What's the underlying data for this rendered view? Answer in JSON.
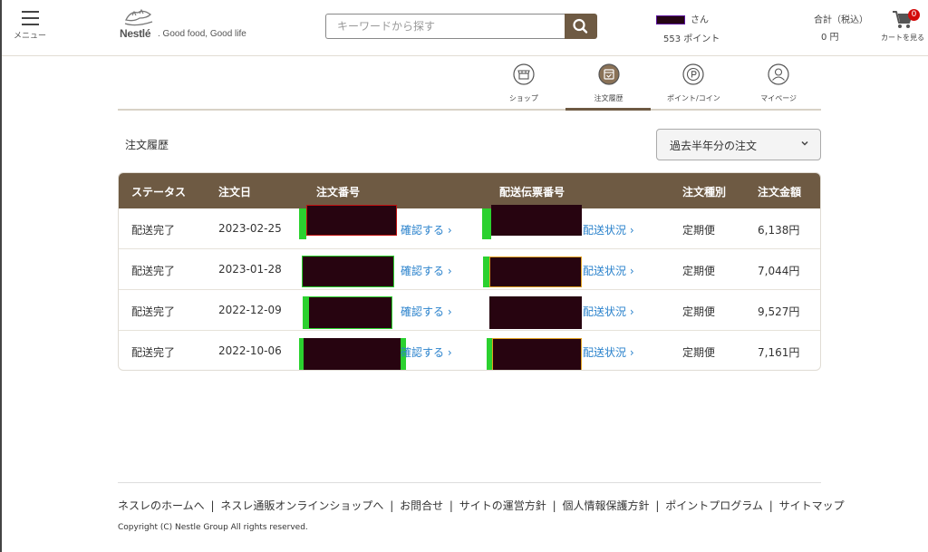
{
  "header": {
    "menu_label": "メニュー",
    "brand": "Nestlé",
    "tagline": ". Good food, Good life",
    "search_placeholder": "キーワードから探す",
    "user_suffix": "さん",
    "points": "553 ポイント",
    "total_label": "合計（税込）",
    "total_value": "0 円",
    "cart_count": "0",
    "cart_label": "カートを見る"
  },
  "tabs": [
    {
      "label": "ショップ",
      "icon": "shop-icon"
    },
    {
      "label": "注文履歴",
      "icon": "order-history-icon",
      "active": true
    },
    {
      "label": "ポイント/コイン",
      "icon": "points-coin-icon"
    },
    {
      "label": "マイページ",
      "icon": "mypage-icon"
    }
  ],
  "page": {
    "title": "注文履歴",
    "period_select": "過去半年分の注文"
  },
  "table": {
    "headers": [
      "ステータス",
      "注文日",
      "注文番号",
      "配送伝票番号",
      "注文種別",
      "注文金額"
    ],
    "confirm_label": "確認する",
    "tracking_label": "配送状況",
    "rows": [
      {
        "status": "配送完了",
        "date": "2023-02-25",
        "type": "定期便",
        "amount": "6,138円"
      },
      {
        "status": "配送完了",
        "date": "2023-01-28",
        "type": "定期便",
        "amount": "7,044円"
      },
      {
        "status": "配送完了",
        "date": "2022-12-09",
        "type": "定期便",
        "amount": "9,527円"
      },
      {
        "status": "配送完了",
        "date": "2022-10-06",
        "type": "定期便",
        "amount": "7,161円"
      }
    ]
  },
  "footer": {
    "links": [
      "ネスレのホームへ",
      "ネスレ通販オンラインショップへ",
      "お問合せ",
      "サイトの運営方針",
      "個人情報保護方針",
      "ポイントプログラム",
      "サイトマップ"
    ],
    "copyright": "Copyright (C) Nestle Group All rights reserved."
  },
  "colors": {
    "accent": "#6e5a43",
    "link": "#2a82cc",
    "badge": "#d30a0a"
  }
}
